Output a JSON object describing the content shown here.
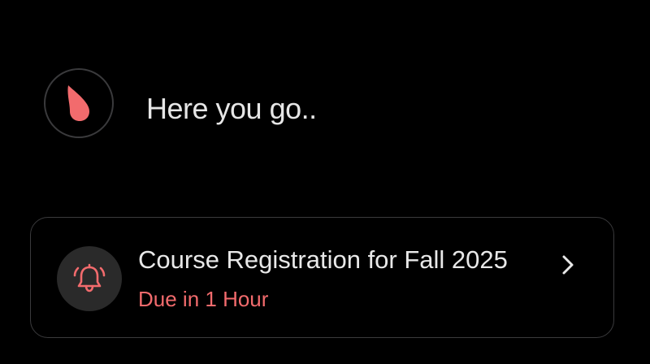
{
  "assistant": {
    "avatar_icon": "droplet-logo-icon",
    "message": "Here you go.."
  },
  "task_card": {
    "icon": "bell-ringing-icon",
    "title": "Course Registration for Fall 2025",
    "due": "Due in 1 Hour",
    "chevron_icon": "chevron-right-icon"
  },
  "colors": {
    "background": "#000000",
    "accent": "#f26b6d",
    "text_primary": "#e8e8e8",
    "border": "#3a3a3c",
    "badge_bg": "#2a2a2a"
  }
}
